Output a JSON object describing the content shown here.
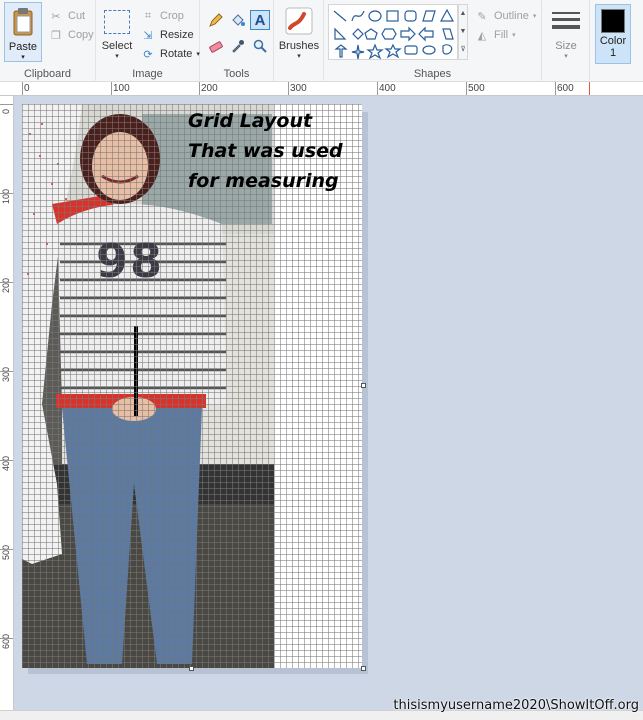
{
  "ribbon": {
    "clipboard": {
      "label": "Clipboard",
      "paste": "Paste",
      "cut": "Cut",
      "copy": "Copy"
    },
    "image": {
      "label": "Image",
      "select": "Select",
      "crop": "Crop",
      "resize": "Resize",
      "rotate": "Rotate"
    },
    "tools": {
      "label": "Tools"
    },
    "brushes": {
      "label": "Brushes"
    },
    "shapes": {
      "label": "Shapes",
      "outline": "Outline",
      "fill": "Fill"
    },
    "size": {
      "label": "Size"
    },
    "color1": {
      "label": "Color",
      "index": "1",
      "value": "#000000"
    }
  },
  "ruler": {
    "top": [
      "0",
      "100",
      "200",
      "300",
      "400",
      "500",
      "600"
    ],
    "left": [
      "0",
      "100",
      "200",
      "300",
      "400",
      "500",
      "600"
    ]
  },
  "canvas": {
    "text_lines": [
      "Grid Layout",
      "That was used",
      "for measuring"
    ],
    "jersey_number": "98"
  },
  "watermark": "thisismyusername2020\\ShowItOff.org",
  "colors": {
    "accent": "#3c87c8",
    "workspace": "#cdd7e6"
  }
}
